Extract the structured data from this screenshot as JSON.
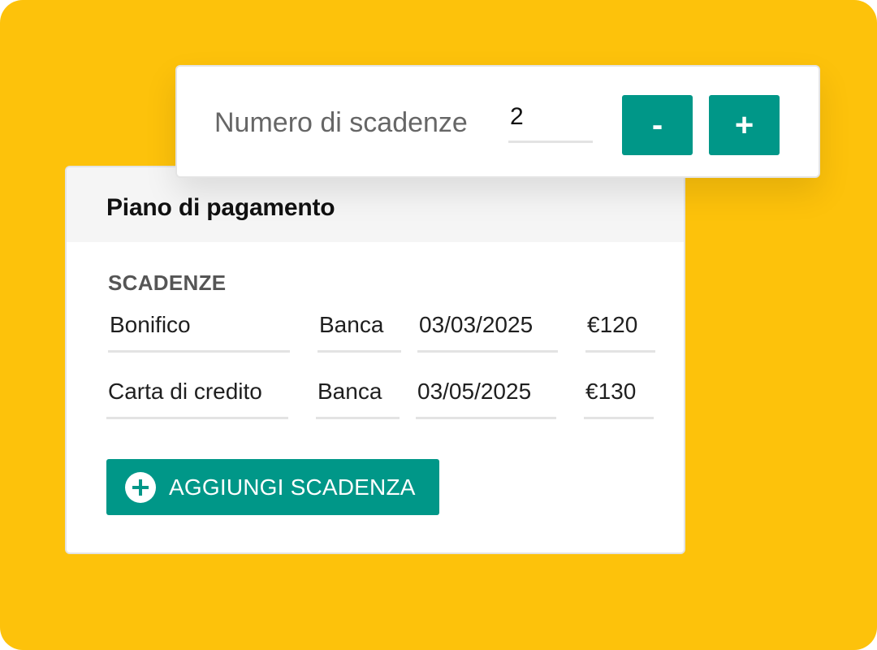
{
  "counter": {
    "label": "Numero di scadenze",
    "value": "2",
    "minus_label": "-",
    "plus_label": "+"
  },
  "plan": {
    "title": "Piano di pagamento",
    "section_label": "SCADENZE",
    "rows": [
      {
        "method": "Bonifico",
        "bank": "Banca",
        "date": "03/03/2025",
        "amount": "€120"
      },
      {
        "method": "Carta di credito",
        "bank": "Banca",
        "date": "03/05/2025",
        "amount": "€130"
      }
    ],
    "add_button_label": "AGGIUNGI SCADENZA",
    "add_button_icon": "plus-circle-icon"
  },
  "colors": {
    "background": "#FDC20B",
    "accent": "#009788",
    "card": "#FFFFFF",
    "header": "#F5F5F5"
  }
}
